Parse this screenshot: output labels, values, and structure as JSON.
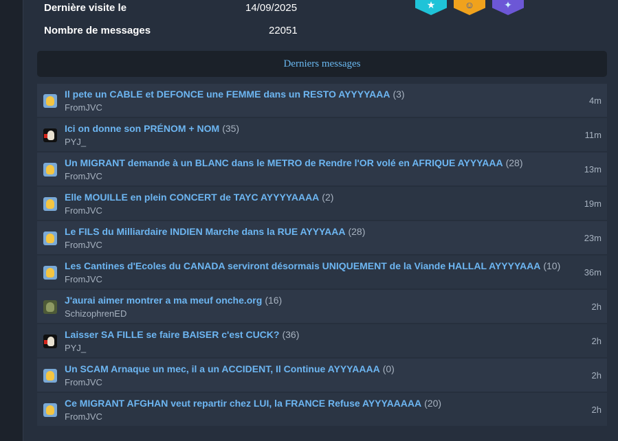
{
  "stats": {
    "last_visit_label": "Dernière visite le",
    "last_visit_value": "14/09/2025",
    "message_count_label": "Nombre de messages",
    "message_count_value": "22051"
  },
  "badges": [
    {
      "icon": "star-badge-icon",
      "glyph": "★",
      "color": "#1fc3d8"
    },
    {
      "icon": "smiley-badge-icon",
      "glyph": "☺",
      "color": "#f0a21d"
    },
    {
      "icon": "gem-badge-icon",
      "glyph": "✦",
      "color": "#6c57d6"
    }
  ],
  "section_title": "Derniers messages",
  "messages": [
    {
      "title": "Il pete un CABLE et DEFONCE une FEMME dans un RESTO AYYYYAAA",
      "count": "(3)",
      "author": "FromJVC",
      "time": "4m",
      "avatar": "fromjvc"
    },
    {
      "title": "Ici on donne son PRÉNOM + NOM",
      "count": "(35)",
      "author": "PYJ_",
      "time": "11m",
      "avatar": "pyj"
    },
    {
      "title": "Un MIGRANT demande à un BLANC dans le METRO de Rendre l'OR volé en AFRIQUE AYYYAAA",
      "count": "(28)",
      "author": "FromJVC",
      "time": "13m",
      "avatar": "fromjvc"
    },
    {
      "title": "Elle MOUILLE en plein CONCERT de TAYC AYYYYAAAA",
      "count": "(2)",
      "author": "FromJVC",
      "time": "19m",
      "avatar": "fromjvc"
    },
    {
      "title": "Le FILS du Milliardaire INDIEN Marche dans la RUE AYYYAAA",
      "count": "(28)",
      "author": "FromJVC",
      "time": "23m",
      "avatar": "fromjvc"
    },
    {
      "title": "Les Cantines d'Ecoles du CANADA serviront désormais UNIQUEMENT de la Viande HALLAL AYYYYAAA",
      "count": "(10)",
      "author": "FromJVC",
      "time": "36m",
      "avatar": "fromjvc"
    },
    {
      "title": "J'aurai aimer montrer a ma meuf onche.org",
      "count": "(16)",
      "author": "SchizophrenED",
      "time": "2h",
      "avatar": "schizo"
    },
    {
      "title": "Laisser SA FILLE se faire BAISER c'est CUCK?",
      "count": "(36)",
      "author": "PYJ_",
      "time": "2h",
      "avatar": "pyj"
    },
    {
      "title": "Un SCAM Arnaque un mec, il a un ACCIDENT, Il Continue AYYYAAAA",
      "count": "(0)",
      "author": "FromJVC",
      "time": "2h",
      "avatar": "fromjvc"
    },
    {
      "title": "Ce MIGRANT AFGHAN veut repartir chez LUI, la FRANCE Refuse AYYYAAAAA",
      "count": "(20)",
      "author": "FromJVC",
      "time": "2h",
      "avatar": "fromjvc"
    }
  ]
}
